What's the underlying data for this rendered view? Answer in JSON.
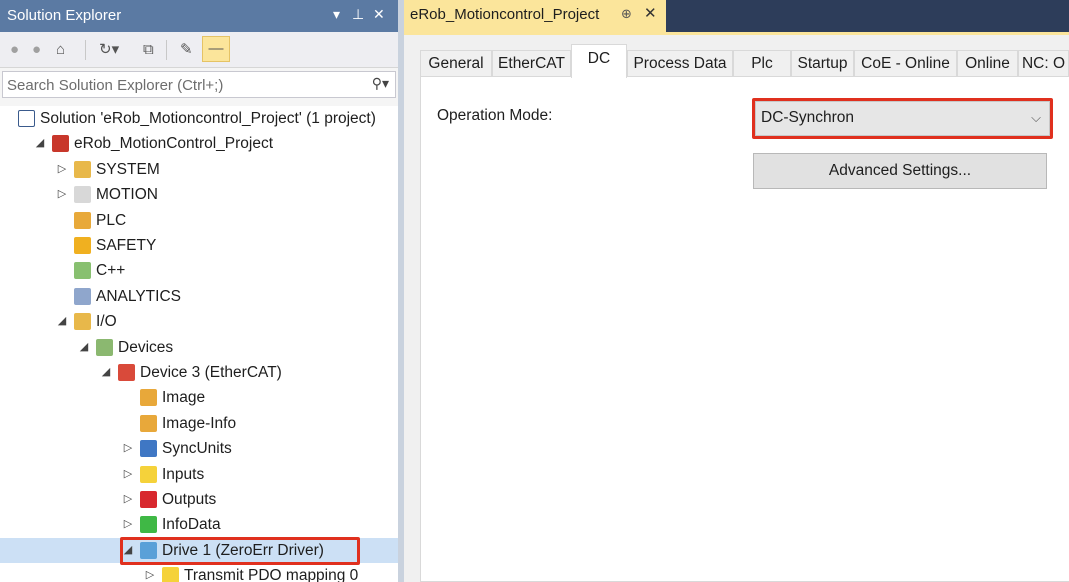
{
  "solution_explorer": {
    "title": "Solution Explorer",
    "title_buttons": {
      "dropdown": "▾",
      "pin": "⊥",
      "close": "✕"
    },
    "search": {
      "placeholder": "Search Solution Explorer (Ctrl+;)",
      "icon": "search-icon"
    },
    "toolbar_icons": [
      "back-icon",
      "forward-icon",
      "home-icon",
      "sync-icon",
      "collapse-all-icon",
      "properties-icon",
      "pending-changes-icon"
    ],
    "tree": [
      {
        "label": "Solution 'eRob_Motioncontrol_Project' (1 project)",
        "icon": "solution-icon",
        "expander": "none",
        "indent": 0
      },
      {
        "label": "eRob_MotionControl_Project",
        "icon": "twincat-project-icon",
        "expander": "expanded",
        "indent": 1
      },
      {
        "label": "SYSTEM",
        "icon": "system-icon",
        "expander": "collapsed",
        "indent": 2
      },
      {
        "label": "MOTION",
        "icon": "motion-icon",
        "expander": "collapsed",
        "indent": 2
      },
      {
        "label": "PLC",
        "icon": "plc-icon",
        "expander": "none",
        "indent": 2
      },
      {
        "label": "SAFETY",
        "icon": "safety-icon",
        "expander": "none",
        "indent": 2
      },
      {
        "label": "C++",
        "icon": "cpp-icon",
        "expander": "none",
        "indent": 2
      },
      {
        "label": "ANALYTICS",
        "icon": "analytics-icon",
        "expander": "none",
        "indent": 2
      },
      {
        "label": "I/O",
        "icon": "io-icon",
        "expander": "expanded",
        "indent": 2
      },
      {
        "label": "Devices",
        "icon": "devices-icon",
        "expander": "expanded",
        "indent": 3
      },
      {
        "label": "Device 3 (EtherCAT)",
        "icon": "ethercat-device-icon",
        "expander": "expanded",
        "indent": 4
      },
      {
        "label": "Image",
        "icon": "image-icon",
        "expander": "none",
        "indent": 5
      },
      {
        "label": "Image-Info",
        "icon": "image-info-icon",
        "expander": "none",
        "indent": 5
      },
      {
        "label": "SyncUnits",
        "icon": "syncunits-icon",
        "expander": "collapsed",
        "indent": 5
      },
      {
        "label": "Inputs",
        "icon": "inputs-icon",
        "expander": "collapsed",
        "indent": 5
      },
      {
        "label": "Outputs",
        "icon": "outputs-icon",
        "expander": "collapsed",
        "indent": 5
      },
      {
        "label": "InfoData",
        "icon": "infodata-icon",
        "expander": "collapsed",
        "indent": 5
      },
      {
        "label": "Drive 1 (ZeroErr Driver)",
        "icon": "drive-icon",
        "expander": "expanded",
        "indent": 5,
        "selected": true
      },
      {
        "label": "Transmit PDO mapping 0",
        "icon": "pdo-icon",
        "expander": "collapsed",
        "indent": 6
      }
    ]
  },
  "document": {
    "tab_title": "eRob_Motioncontrol_Project",
    "tab_pin": "⊕",
    "tab_close": "✕",
    "tabs": [
      {
        "label": "General"
      },
      {
        "label": "EtherCAT"
      },
      {
        "label": "DC",
        "active": true
      },
      {
        "label": "Process Data"
      },
      {
        "label": "Plc"
      },
      {
        "label": "Startup"
      },
      {
        "label": "CoE - Online"
      },
      {
        "label": "Online"
      },
      {
        "label": "NC: O"
      }
    ],
    "operation_mode_label": "Operation Mode:",
    "operation_mode_value": "DC-Synchron",
    "advanced_button": "Advanced Settings..."
  },
  "colors": {
    "title_bar": "#5b7aa3",
    "doc_tabstrip": "#2d3d5a",
    "doc_tab_active": "#fbe59b",
    "highlight_red": "#e0301e",
    "selection": "#cce0f5"
  }
}
